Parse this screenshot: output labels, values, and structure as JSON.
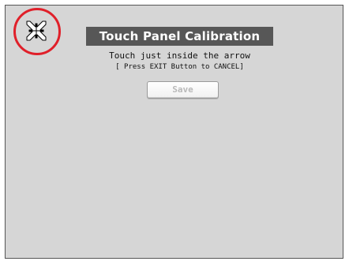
{
  "dialog": {
    "title": "Touch Panel Calibration",
    "instruction": "Touch just inside the arrow",
    "cancel_hint": "[ Press EXIT Button to CANCEL]",
    "save_label": "Save",
    "save_enabled": false
  },
  "calibration_target": {
    "icon": "calibration-arrows-icon",
    "highlight_color": "#e0202a"
  },
  "colors": {
    "background": "#d6d6d6",
    "title_bar": "#575757"
  }
}
